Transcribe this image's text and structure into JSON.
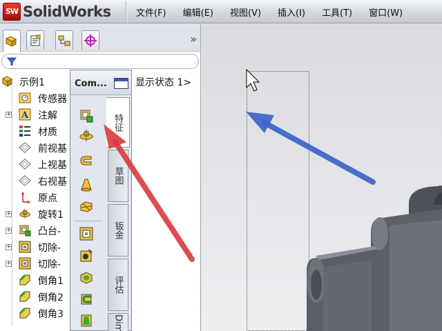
{
  "app": {
    "logo_badge": "SW",
    "name": "SolidWorks"
  },
  "menu": [
    "文件(F)",
    "编辑(E)",
    "视图(V)",
    "插入(I)",
    "工具(T)",
    "窗口(W)"
  ],
  "panel": {
    "tabs": [
      "featuremanager-tab",
      "propertymanager-tab",
      "configurationmanager-tab",
      "dimxpert-tab"
    ],
    "collapse_glyph": "»",
    "filter_icon": "funnel-icon",
    "root": {
      "label": "示例1",
      "suffix": "显示状态 1>"
    },
    "items": [
      {
        "label": "传感器",
        "icon": "sensor-icon",
        "expandable": false
      },
      {
        "label": "注解",
        "icon": "annotation-icon",
        "expandable": true
      },
      {
        "label": "材质",
        "icon": "material-icon",
        "expandable": false
      },
      {
        "label": "前视基",
        "icon": "plane-icon",
        "expandable": false
      },
      {
        "label": "上视基",
        "icon": "plane-icon",
        "expandable": false
      },
      {
        "label": "右视基",
        "icon": "plane-icon",
        "expandable": false
      },
      {
        "label": "原点",
        "icon": "origin-icon",
        "expandable": false
      },
      {
        "label": "旋转1",
        "icon": "revolve-icon",
        "expandable": true
      },
      {
        "label": "凸台-",
        "icon": "boss-icon",
        "expandable": true
      },
      {
        "label": "切除-",
        "icon": "cut-icon",
        "expandable": true
      },
      {
        "label": "切除-",
        "icon": "cut-icon",
        "expandable": true
      },
      {
        "label": "倒角1",
        "icon": "chamfer-icon",
        "expandable": false
      },
      {
        "label": "倒角2",
        "icon": "chamfer-icon",
        "expandable": false
      },
      {
        "label": "倒角3",
        "icon": "chamfer-icon",
        "expandable": false
      }
    ]
  },
  "command_manager": {
    "title": "Com...",
    "tools": [
      "extruded-boss-icon",
      "revolved-boss-icon",
      "swept-boss-icon",
      "lofted-boss-icon",
      "boundary-boss-icon",
      "extruded-cut-icon",
      "hole-wizard-icon",
      "revolved-cut-icon",
      "swept-cut-icon",
      "lofted-cut-icon"
    ],
    "tabs": [
      "特征",
      "草图",
      "钣金",
      "评估",
      "Dim"
    ]
  },
  "colors": {
    "red_arrow": "#d93a3a",
    "blue_arrow": "#3c63c8",
    "part_gray": "#6c7079"
  }
}
